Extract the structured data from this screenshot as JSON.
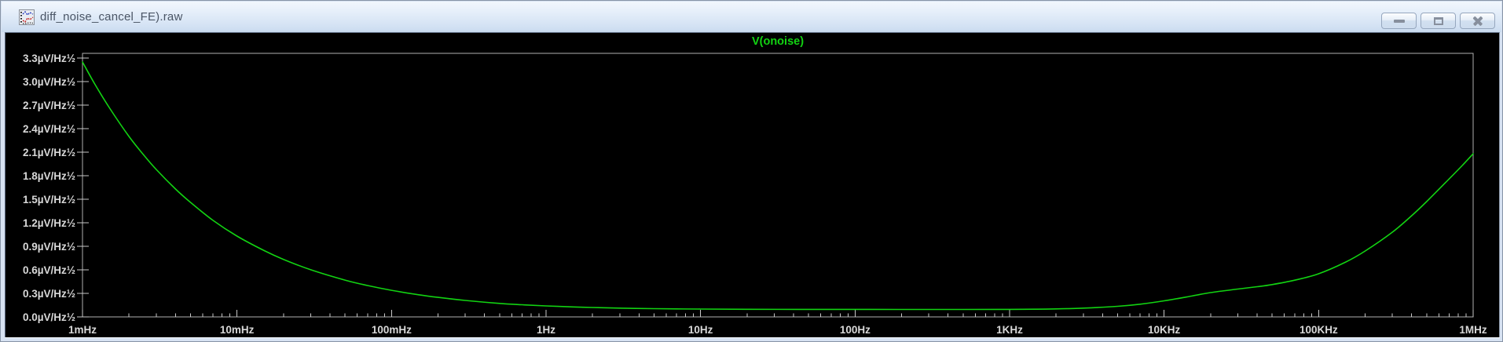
{
  "window": {
    "title": "diff_noise_cancel_FE).raw",
    "icon": "waveform-document-icon",
    "buttons": {
      "minimize": "minimize",
      "maximize": "maximize",
      "close": "close"
    }
  },
  "chart_data": {
    "type": "line",
    "title": "V(onoise)",
    "x_scale": "log",
    "x_unit": "Hz",
    "y_unit": "µV/Hz½",
    "x_range": [
      0.001,
      1000000
    ],
    "y_range": [
      0,
      3.36
    ],
    "grid": false,
    "legend_position": "top-center",
    "colors": {
      "trace": "#12d312",
      "axis_border": "#b0b0b0",
      "tick": "#c9c9c9",
      "axis_text": "#d8d8d8",
      "background": "#000000"
    },
    "x_ticks": [
      {
        "f": 0.001,
        "label": "1mHz"
      },
      {
        "f": 0.01,
        "label": "10mHz"
      },
      {
        "f": 0.1,
        "label": "100mHz"
      },
      {
        "f": 1,
        "label": "1Hz"
      },
      {
        "f": 10,
        "label": "10Hz"
      },
      {
        "f": 100,
        "label": "100Hz"
      },
      {
        "f": 1000,
        "label": "1KHz"
      },
      {
        "f": 10000,
        "label": "10KHz"
      },
      {
        "f": 100000,
        "label": "100KHz"
      },
      {
        "f": 1000000,
        "label": "1MHz"
      }
    ],
    "y_ticks": [
      {
        "v": 0.0,
        "label": "0.0µV/Hz½"
      },
      {
        "v": 0.3,
        "label": "0.3µV/Hz½"
      },
      {
        "v": 0.6,
        "label": "0.6µV/Hz½"
      },
      {
        "v": 0.9,
        "label": "0.9µV/Hz½"
      },
      {
        "v": 1.2,
        "label": "1.2µV/Hz½"
      },
      {
        "v": 1.5,
        "label": "1.5µV/Hz½"
      },
      {
        "v": 1.8,
        "label": "1.8µV/Hz½"
      },
      {
        "v": 2.1,
        "label": "2.1µV/Hz½"
      },
      {
        "v": 2.4,
        "label": "2.4µV/Hz½"
      },
      {
        "v": 2.7,
        "label": "2.7µV/Hz½"
      },
      {
        "v": 3.0,
        "label": "3.0µV/Hz½"
      },
      {
        "v": 3.3,
        "label": "3.3µV/Hz½"
      }
    ],
    "series": [
      {
        "name": "V(onoise)",
        "color": "#12d312",
        "points": [
          [
            0.001,
            3.25
          ],
          [
            0.0012,
            2.97
          ],
          [
            0.0015,
            2.66
          ],
          [
            0.002,
            2.3
          ],
          [
            0.0025,
            2.06
          ],
          [
            0.003,
            1.88
          ],
          [
            0.004,
            1.63
          ],
          [
            0.005,
            1.46
          ],
          [
            0.007,
            1.23
          ],
          [
            0.01,
            1.03
          ],
          [
            0.015,
            0.845
          ],
          [
            0.02,
            0.733
          ],
          [
            0.03,
            0.601
          ],
          [
            0.05,
            0.469
          ],
          [
            0.07,
            0.4
          ],
          [
            0.1,
            0.339
          ],
          [
            0.15,
            0.282
          ],
          [
            0.2,
            0.249
          ],
          [
            0.3,
            0.21
          ],
          [
            0.5,
            0.172
          ],
          [
            0.7,
            0.155
          ],
          [
            1,
            0.14
          ],
          [
            1.5,
            0.127
          ],
          [
            2,
            0.12
          ],
          [
            3,
            0.112
          ],
          [
            5,
            0.105
          ],
          [
            7,
            0.102
          ],
          [
            10,
            0.1
          ],
          [
            20,
            0.097
          ],
          [
            50,
            0.0957
          ],
          [
            100,
            0.0953
          ],
          [
            200,
            0.095
          ],
          [
            500,
            0.095
          ],
          [
            1000,
            0.096
          ],
          [
            1500,
            0.098
          ],
          [
            2000,
            0.102
          ],
          [
            3000,
            0.112
          ],
          [
            5000,
            0.135
          ],
          [
            7000,
            0.162
          ],
          [
            10000,
            0.205
          ],
          [
            15000,
            0.265
          ],
          [
            20000,
            0.31
          ],
          [
            30000,
            0.355
          ],
          [
            40000,
            0.385
          ],
          [
            50000,
            0.412
          ],
          [
            70000,
            0.468
          ],
          [
            100000,
            0.55
          ],
          [
            150000,
            0.7
          ],
          [
            200000,
            0.84
          ],
          [
            300000,
            1.08
          ],
          [
            400000,
            1.29
          ],
          [
            500000,
            1.47
          ],
          [
            700000,
            1.76
          ],
          [
            850000,
            1.93
          ],
          [
            1000000,
            2.08
          ]
        ]
      }
    ]
  }
}
